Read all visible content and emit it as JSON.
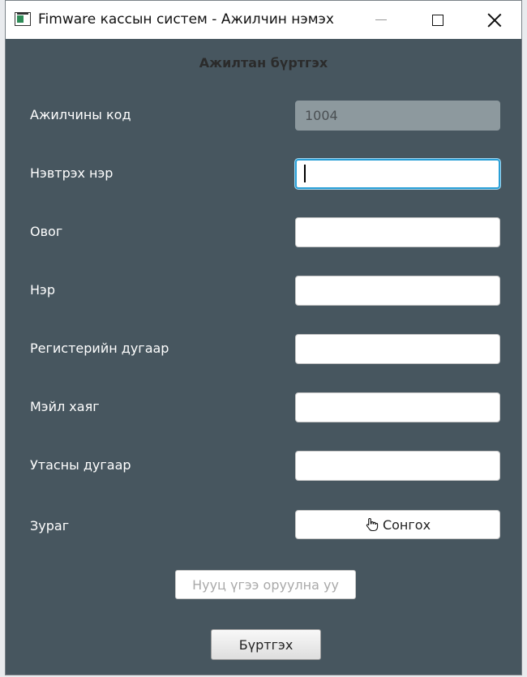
{
  "window": {
    "title": "Fimware кассын систем - Ажилчин нэмэх"
  },
  "form": {
    "heading": "Ажилтан бүртгэх",
    "fields": [
      {
        "label": "Ажилчины код",
        "value": "1004",
        "state": "disabled"
      },
      {
        "label": "Нэвтрэх нэр",
        "value": "",
        "state": "focused"
      },
      {
        "label": "Овог",
        "value": ""
      },
      {
        "label": "Нэр",
        "value": ""
      },
      {
        "label": "Регистерийн дугаар",
        "value": ""
      },
      {
        "label": "Мэйл хаяг",
        "value": ""
      },
      {
        "label": "Утасны дугаар",
        "value": ""
      }
    ],
    "photo": {
      "label": "Зураг",
      "button_label": "Сонгох",
      "button_icon": "hand-pointer-icon"
    },
    "password": {
      "placeholder": "Нууц үгээ оруулна уу",
      "value": ""
    },
    "submit_label": "Бүртгэх"
  },
  "colors": {
    "background": "#47565f",
    "focus_border": "#2a9fd6",
    "disabled_field": "#8d999e"
  }
}
